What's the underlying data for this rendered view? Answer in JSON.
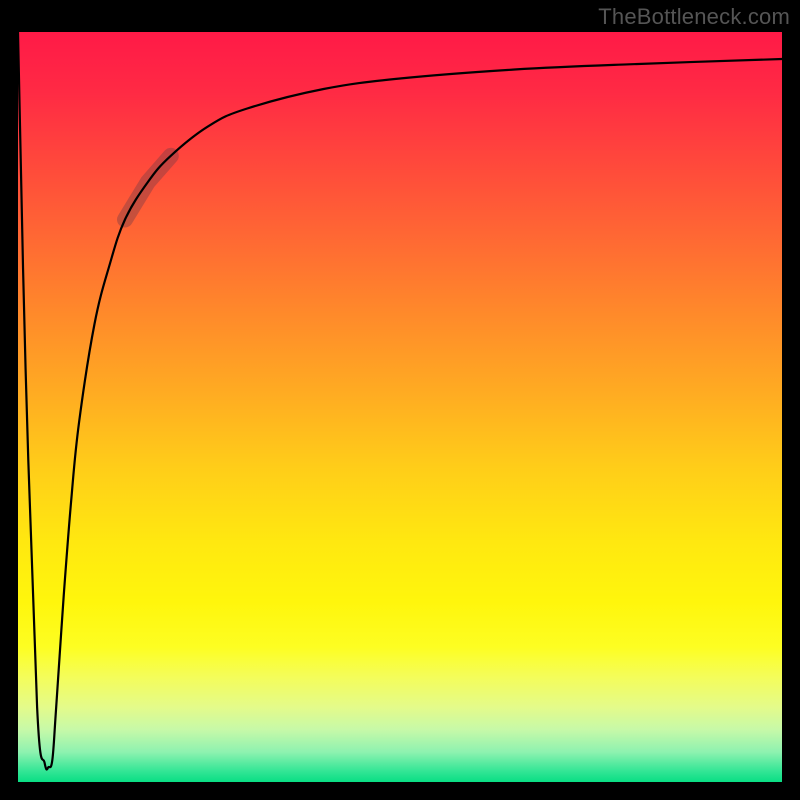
{
  "watermark": "TheBottleneck.com",
  "chart_data": {
    "type": "line",
    "title": "",
    "xlabel": "",
    "ylabel": "",
    "x_range": [
      0,
      100
    ],
    "y_range": [
      0,
      100
    ],
    "grid": false,
    "legend": false,
    "series": [
      {
        "name": "curve",
        "x": [
          0.0,
          1.0,
          2.5,
          3.5,
          4.0,
          4.5,
          5.0,
          6.0,
          7.0,
          8.0,
          10.0,
          12.0,
          14.0,
          17.0,
          20.0,
          25.0,
          30.0,
          40.0,
          50.0,
          65.0,
          80.0,
          100.0
        ],
        "y": [
          100.0,
          55.0,
          10.0,
          2.5,
          2.0,
          3.0,
          10.0,
          25.0,
          38.0,
          48.0,
          61.0,
          69.0,
          75.0,
          80.0,
          83.5,
          87.5,
          89.8,
          92.4,
          93.8,
          95.0,
          95.7,
          96.4
        ]
      }
    ],
    "highlight_segment": {
      "x_start": 14.0,
      "x_end": 20.0
    },
    "colors": {
      "curve": "#000000",
      "smudge": "rgba(120,60,70,0.42)",
      "gradient_top": "#ff1a47",
      "gradient_bottom": "#09de84"
    }
  }
}
